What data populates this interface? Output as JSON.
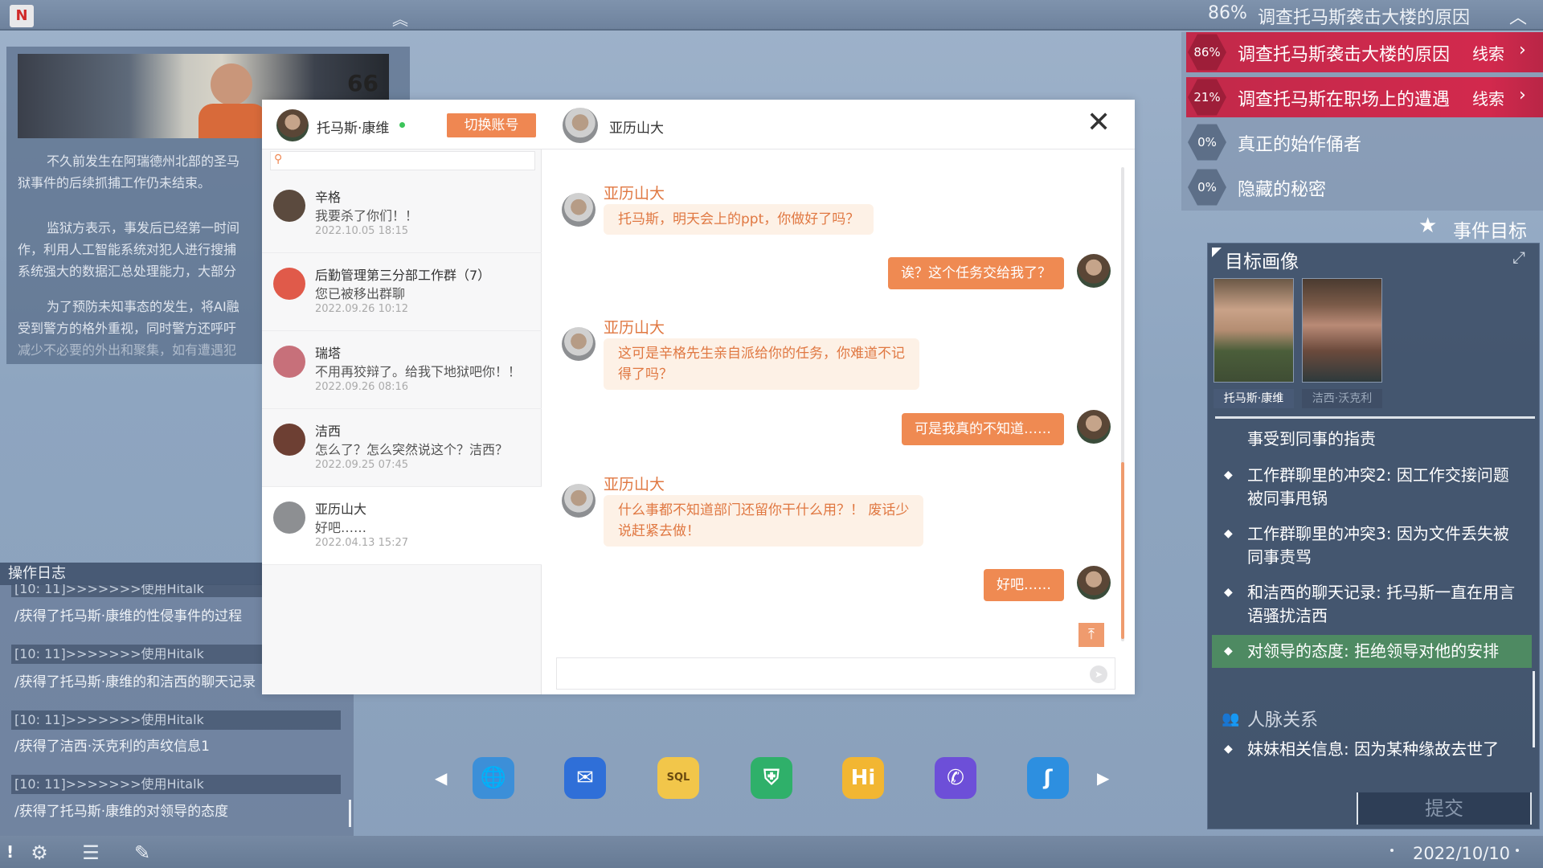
{
  "topbar": {
    "progress": "86%",
    "task": "调查托马斯袭击大楼的原因"
  },
  "article": {
    "image_number": "66",
    "paragraphs": [
      [
        "不久前发生在阿瑞德州北部的圣马",
        "狱事件的后续抓捕工作仍未结束。"
      ],
      [
        "监狱方表示，事发后已经第一时间",
        "作，利用人工智能系统对犯人进行搜捕",
        "系统强大的数据汇总处理能力，大部分"
      ],
      [
        "为了预防未知事态的发生，将AI融",
        "受到警方的格外重视，同时警方还呼吁",
        "减少不必要的外出和聚集，如有遭遇犯"
      ]
    ]
  },
  "log": {
    "title": "操作日志",
    "entries": [
      {
        "time": "[10: 11]>>>>>>>使用Hitalk",
        "text": "/获得了托马斯·康维的性侵事件的过程"
      },
      {
        "time": "[10: 11]>>>>>>>使用Hitalk",
        "text": "/获得了托马斯·康维的和洁西的聊天记录"
      },
      {
        "time": "[10: 11]>>>>>>>使用Hitalk",
        "text": "/获得了洁西·沃克利的声纹信息1"
      },
      {
        "time": "[10: 11]>>>>>>>使用Hitalk",
        "text": "/获得了托马斯·康维的对领导的态度"
      }
    ]
  },
  "chat": {
    "account_name": "托马斯·康维",
    "switch_label": "切换账号",
    "search_placeholder": "",
    "contacts": [
      {
        "name": "辛格",
        "msg": "我要杀了你们！！",
        "time": "2022.10.05 18:15",
        "avatar_color": "#5b4a3e"
      },
      {
        "name": "后勤管理第三分部工作群（7）",
        "msg": "您已被移出群聊",
        "time": "2022.09.26 10:12",
        "avatar_color": "#e05a4a"
      },
      {
        "name": "瑞塔",
        "msg": "不用再狡辩了。给我下地狱吧你！！",
        "time": "2022.09.26 08:16",
        "avatar_color": "#c7707a"
      },
      {
        "name": "洁西",
        "msg": "怎么了？怎么突然说这个？洁西？",
        "time": "2022.09.25 07:45",
        "avatar_color": "#6d3f33"
      },
      {
        "name": "亚历山大",
        "msg": "好吧……",
        "time": "2022.04.13 15:27",
        "avatar_color": "#8d8f92"
      }
    ],
    "peer_name": "亚历山大",
    "messages": [
      {
        "from": "peer",
        "name": "亚历山大",
        "lines": [
          "托马斯，明天会上的ppt，你做好了吗？"
        ]
      },
      {
        "from": "me",
        "lines": [
          "诶？这个任务交给我了？"
        ]
      },
      {
        "from": "peer",
        "name": "亚历山大",
        "lines": [
          "这可是辛格先生亲自派给你的任务，你难道不记",
          "得了吗？"
        ]
      },
      {
        "from": "me",
        "lines": [
          "可是我真的不知道……"
        ]
      },
      {
        "from": "peer",
        "name": "亚历山大",
        "lines": [
          "什么事都不知道部门还留你干什么用？！ 废话少",
          "说赶紧去做！"
        ]
      },
      {
        "from": "me",
        "lines": [
          "好吧……"
        ]
      }
    ]
  },
  "dock": {
    "icons": [
      {
        "name": "browser-icon",
        "glyph": "🌐",
        "bg": "#3c8fd8"
      },
      {
        "name": "mail-icon",
        "glyph": "✉",
        "bg": "#2f6fd8"
      },
      {
        "name": "sql-file-icon",
        "glyph": "SQL",
        "bg": "#f2c64a"
      },
      {
        "name": "shield-icon",
        "glyph": "⛨",
        "bg": "#2fb06a"
      },
      {
        "name": "hitalk-icon",
        "glyph": "Hi",
        "bg": "#f2b632"
      },
      {
        "name": "phone-icon",
        "glyph": "✆",
        "bg": "#6d4fd8"
      },
      {
        "name": "hook-icon",
        "glyph": "ʃ",
        "bg": "#2d8fe0"
      }
    ]
  },
  "bottombar": {
    "date": "2022/10/10"
  },
  "tasks": [
    {
      "progress": "86%",
      "label": "调查托马斯袭击大楼的原因",
      "clue": "线索",
      "active": true
    },
    {
      "progress": "21%",
      "label": "调查托马斯在职场上的遭遇",
      "clue": "线索",
      "active": true
    },
    {
      "progress": "0%",
      "label": "真正的始作俑者",
      "clue": "",
      "active": false
    },
    {
      "progress": "0%",
      "label": "隐藏的秘密",
      "clue": "",
      "active": false
    }
  ],
  "event_goal": "事件目标",
  "target": {
    "title": "目标画像",
    "portraits": [
      "托马斯·康维",
      "洁西·沃克利"
    ],
    "clues": [
      {
        "text": "事受到同事的指责",
        "bullet": false,
        "hl": false
      },
      {
        "text": "工作群聊里的冲突2: 因工作交接问题被同事甩锅",
        "bullet": true,
        "hl": false
      },
      {
        "text": "工作群聊里的冲突3: 因为文件丢失被同事责骂",
        "bullet": true,
        "hl": false
      },
      {
        "text": "和洁西的聊天记录: 托马斯一直在用言语骚扰洁西",
        "bullet": true,
        "hl": false
      },
      {
        "text": "对领导的态度: 拒绝领导对他的安排",
        "bullet": true,
        "hl": true
      }
    ],
    "relations_title": "人脉关系",
    "relation_clue": "妹妹相关信息: 因为某种缘故去世了",
    "submit_label": "提交"
  }
}
